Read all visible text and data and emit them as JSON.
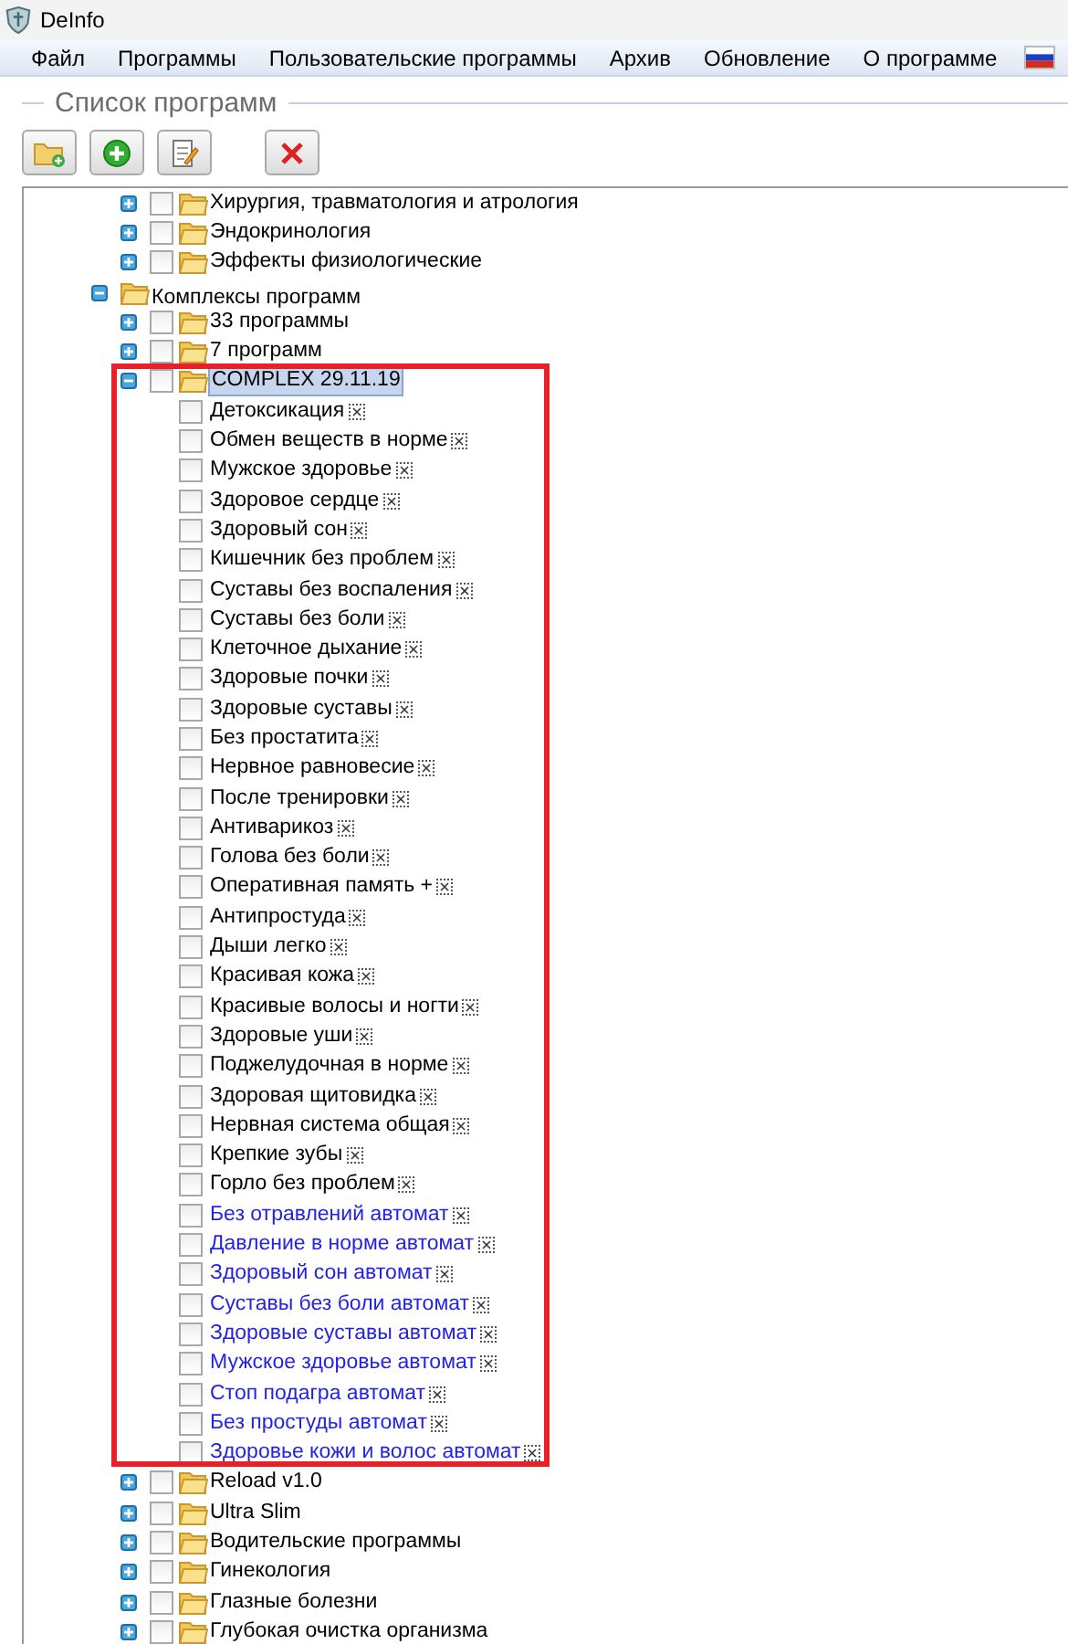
{
  "window": {
    "title": "DeInfo"
  },
  "menu": [
    {
      "label": "Файл"
    },
    {
      "label": "Программы"
    },
    {
      "label": "Пользовательские программы"
    },
    {
      "label": "Архив"
    },
    {
      "label": "Обновление"
    },
    {
      "label": "О программе"
    }
  ],
  "group_title": "Список программ",
  "tree": {
    "upper_items": [
      {
        "kind": "folder",
        "label": "Хирургия, травматология и атрология",
        "expanded": false,
        "checked": false,
        "selected": false
      },
      {
        "kind": "folder",
        "label": "Эндокринология",
        "expanded": false,
        "checked": false,
        "selected": false
      },
      {
        "kind": "folder",
        "label": "Эффекты физиологические",
        "expanded": false,
        "checked": false,
        "selected": false
      }
    ],
    "nodes": [
      {
        "kind": "group",
        "label": "Комплексы программ",
        "expanded": true,
        "selected": false,
        "children": [
          {
            "kind": "folder",
            "label": "33 программы",
            "expanded": false,
            "checked": false,
            "selected": false
          },
          {
            "kind": "folder",
            "label": "7 программ",
            "expanded": false,
            "checked": false,
            "selected": false
          },
          {
            "kind": "folder",
            "label": "COMPLEX 29.11.19",
            "expanded": true,
            "checked": false,
            "selected": true,
            "highlighted": true,
            "children": [
              {
                "kind": "program",
                "label": "Детоксикация",
                "checked": false,
                "selected": false
              },
              {
                "kind": "program",
                "label": "Обмен веществ в норме",
                "checked": false,
                "selected": false
              },
              {
                "kind": "program",
                "label": "Мужское здоровье",
                "checked": false,
                "selected": false
              },
              {
                "kind": "program",
                "label": "Здоровое сердце",
                "checked": false,
                "selected": false
              },
              {
                "kind": "program",
                "label": "Здоровый сон",
                "checked": false,
                "selected": false
              },
              {
                "kind": "program",
                "label": "Кишечник без проблем",
                "checked": false,
                "selected": false
              },
              {
                "kind": "program",
                "label": "Суставы без воспаления",
                "checked": false,
                "selected": false
              },
              {
                "kind": "program",
                "label": "Суставы без боли",
                "checked": false,
                "selected": false
              },
              {
                "kind": "program",
                "label": "Клеточное дыхание",
                "checked": false,
                "selected": false
              },
              {
                "kind": "program",
                "label": "Здоровые почки",
                "checked": false,
                "selected": false
              },
              {
                "kind": "program",
                "label": "Здоровые суставы",
                "checked": false,
                "selected": false
              },
              {
                "kind": "program",
                "label": "Без простатита",
                "checked": false,
                "selected": false
              },
              {
                "kind": "program",
                "label": "Нервное равновесие",
                "checked": false,
                "selected": false
              },
              {
                "kind": "program",
                "label": "После тренировки",
                "checked": false,
                "selected": false
              },
              {
                "kind": "program",
                "label": "Антиварикоз",
                "checked": false,
                "selected": false
              },
              {
                "kind": "program",
                "label": "Голова без боли",
                "checked": false,
                "selected": false
              },
              {
                "kind": "program",
                "label": "Оперативная память +",
                "checked": false,
                "selected": false
              },
              {
                "kind": "program",
                "label": "Антипростуда",
                "checked": false,
                "selected": false
              },
              {
                "kind": "program",
                "label": "Дыши легко",
                "checked": false,
                "selected": false
              },
              {
                "kind": "program",
                "label": "Красивая кожа",
                "checked": false,
                "selected": false
              },
              {
                "kind": "program",
                "label": "Красивые волосы и ногти",
                "checked": false,
                "selected": false
              },
              {
                "kind": "program",
                "label": "Здоровые уши",
                "checked": false,
                "selected": false
              },
              {
                "kind": "program",
                "label": "Поджелудочная в норме",
                "checked": false,
                "selected": false
              },
              {
                "kind": "program",
                "label": "Здоровая щитовидка",
                "checked": false,
                "selected": false
              },
              {
                "kind": "program",
                "label": "Нервная система общая",
                "checked": false,
                "selected": false
              },
              {
                "kind": "program",
                "label": "Крепкие зубы",
                "checked": false,
                "selected": false
              },
              {
                "kind": "program",
                "label": "Горло без проблем",
                "checked": false,
                "selected": false
              },
              {
                "kind": "auto",
                "label": "Без отравлений автомат",
                "checked": false,
                "selected": false
              },
              {
                "kind": "auto",
                "label": "Давление в норме автомат",
                "checked": false,
                "selected": false
              },
              {
                "kind": "auto",
                "label": "Здоровый сон автомат",
                "checked": false,
                "selected": false
              },
              {
                "kind": "auto",
                "label": "Суставы без боли автомат",
                "checked": false,
                "selected": false
              },
              {
                "kind": "auto",
                "label": "Здоровые суставы автомат",
                "checked": false,
                "selected": false
              },
              {
                "kind": "auto",
                "label": "Мужское здоровье автомат",
                "checked": false,
                "selected": false
              },
              {
                "kind": "auto",
                "label": "Стоп подагра автомат",
                "checked": false,
                "selected": false
              },
              {
                "kind": "auto",
                "label": "Без простуды автомат",
                "checked": false,
                "selected": false
              },
              {
                "kind": "auto",
                "label": "Здоровье кожи и волос автомат",
                "checked": false,
                "selected": false
              }
            ]
          },
          {
            "kind": "folder",
            "label": "Reload v1.0",
            "expanded": false,
            "checked": false,
            "selected": false
          },
          {
            "kind": "folder",
            "label": "Ultra Slim",
            "expanded": false,
            "checked": false,
            "selected": false
          },
          {
            "kind": "folder",
            "label": "Водительские программы",
            "expanded": false,
            "checked": false,
            "selected": false
          },
          {
            "kind": "folder",
            "label": "Гинекология",
            "expanded": false,
            "checked": false,
            "selected": false
          },
          {
            "kind": "folder",
            "label": "Глазные болезни",
            "expanded": false,
            "checked": false,
            "selected": false
          },
          {
            "kind": "folder",
            "label": "Глубокая очистка организма",
            "expanded": false,
            "checked": false,
            "selected": false
          }
        ]
      }
    ]
  }
}
